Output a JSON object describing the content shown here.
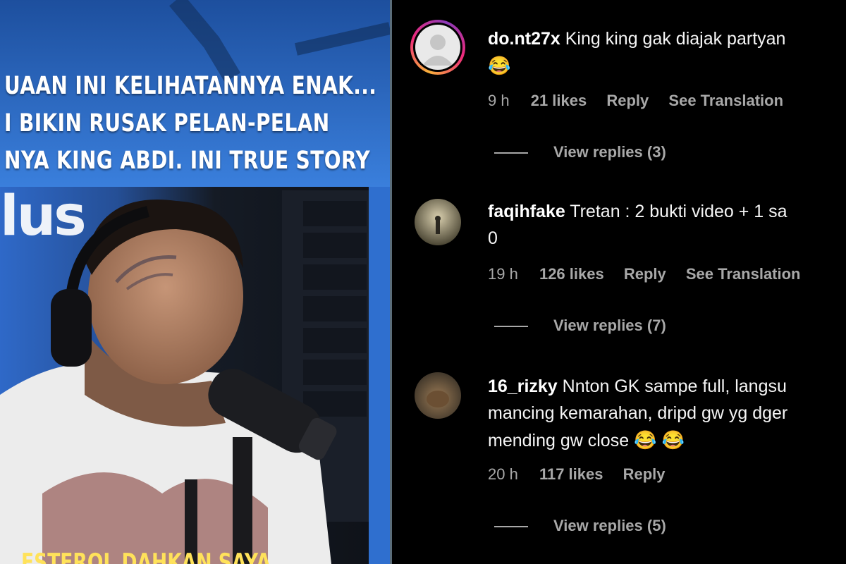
{
  "video": {
    "caption_lines": [
      "UAAN INI KELIHATANNYA ENAK...",
      "I BIKIN RUSAK PELAN-PELAN",
      "NYA KING ABDI. INI TRUE STORY"
    ],
    "logo_fragment": "lus",
    "bottom_caption": "ESTEROL DAHKAN SAYA"
  },
  "comments": [
    {
      "username": "do.nt27x",
      "text": "King king gak diajak partyan",
      "emoji": "😂",
      "time": "9 h",
      "likes": "21 likes",
      "reply_label": "Reply",
      "translate_label": "See Translation",
      "view_replies": "View replies (3)",
      "avatar_icon": "default-profile-icon"
    },
    {
      "username": "faqihfake",
      "text": "Tretan : 2 bukti video + 1 sa",
      "text_line2": "0",
      "time": "19 h",
      "likes": "126 likes",
      "reply_label": "Reply",
      "translate_label": "See Translation",
      "view_replies": "View replies (7)"
    },
    {
      "username": "16_rizky",
      "text": "Nnton GK sampe full, langsu",
      "text_line2": "mancing kemarahan, dripd gw yg dger",
      "text_line3": "mending gw close",
      "emoji": "😂 😂",
      "time": "20 h",
      "likes": "117 likes",
      "reply_label": "Reply",
      "view_replies": "View replies (5)"
    }
  ],
  "colors": {
    "background": "#000000",
    "text": "#f5f5f5",
    "muted": "#a8a8a8",
    "video_blue": "#2d68c4"
  }
}
